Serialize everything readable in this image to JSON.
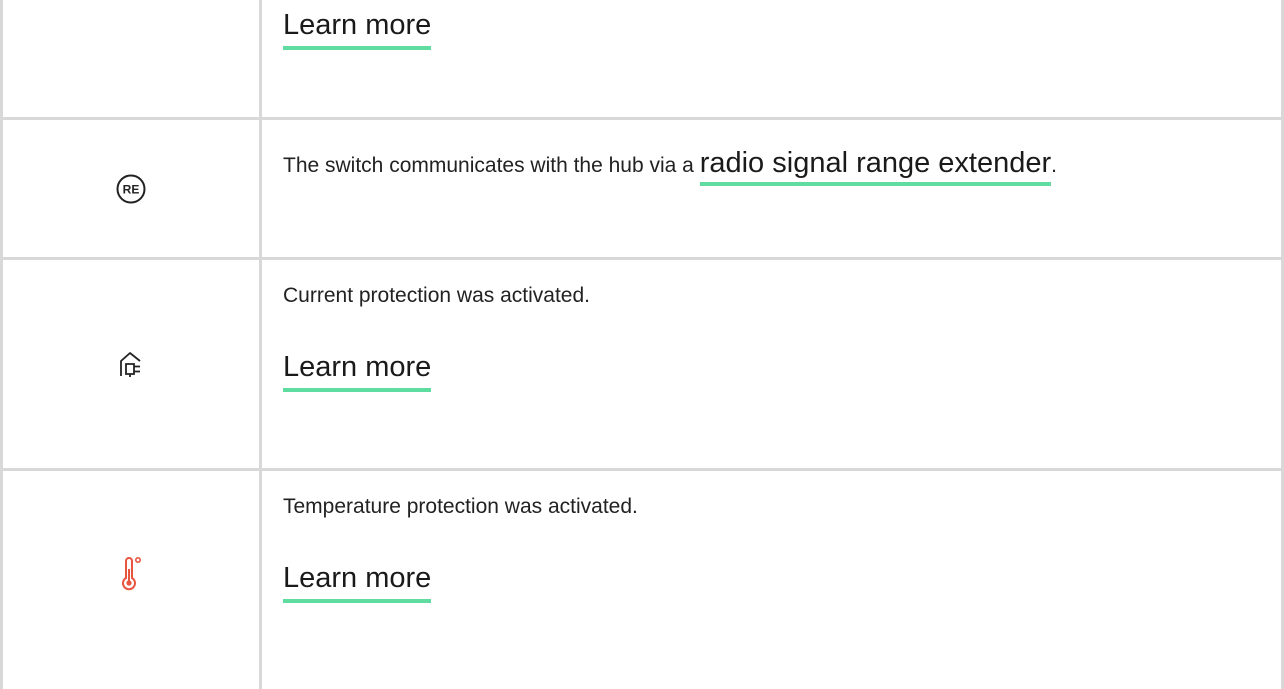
{
  "rows": [
    {
      "link": "Learn more"
    },
    {
      "icon": "re-icon",
      "text_before": "The switch communicates with the hub via a ",
      "link": "radio signal range extender",
      "text_after": "."
    },
    {
      "icon": "plug-home-icon",
      "description": "Current protection was activated.",
      "link": "Learn more"
    },
    {
      "icon": "thermometer-icon",
      "description": "Temperature protection was activated.",
      "link": "Learn more"
    }
  ],
  "re_icon_label": "RE",
  "colors": {
    "accent_underline": "#5fdca0",
    "border": "#d8d8d8",
    "thermometer": "#e8553f"
  }
}
